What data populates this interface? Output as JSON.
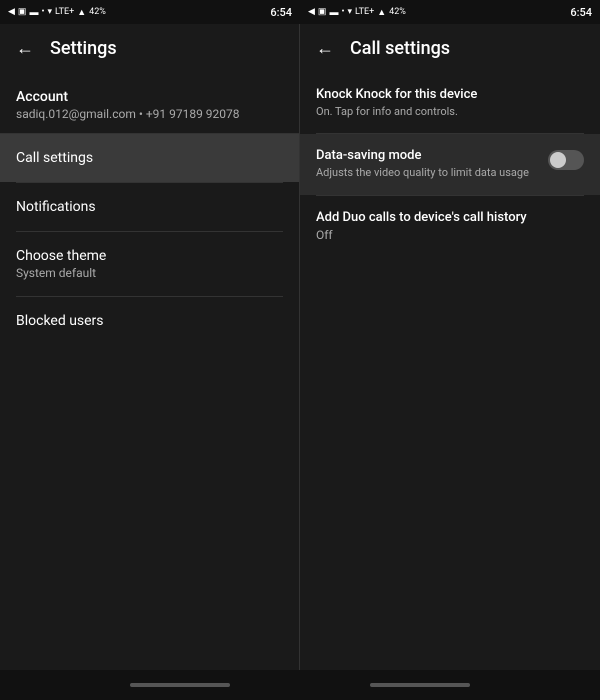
{
  "statusBar": {
    "left": {
      "time": "6:54",
      "icons": [
        "◀",
        "▣",
        "▬",
        "•",
        "•",
        "▾",
        "LTE+",
        "▲",
        "42%"
      ]
    },
    "right": {
      "time": "6:54",
      "icons": [
        "◀",
        "▣",
        "▬",
        "•",
        "•",
        "▾",
        "LTE+",
        "▲",
        "42%"
      ]
    }
  },
  "leftPanel": {
    "header": {
      "backLabel": "←",
      "title": "Settings"
    },
    "account": {
      "label": "Account",
      "info": "sadiq.012@gmail.com • +91 97189 92078"
    },
    "menuItems": [
      {
        "id": "call-settings",
        "title": "Call settings",
        "subtitle": "",
        "active": true
      },
      {
        "id": "notifications",
        "title": "Notifications",
        "subtitle": "",
        "active": false
      },
      {
        "id": "choose-theme",
        "title": "Choose theme",
        "subtitle": "System default",
        "active": false
      },
      {
        "id": "blocked-users",
        "title": "Blocked users",
        "subtitle": "",
        "active": false
      }
    ]
  },
  "rightPanel": {
    "header": {
      "backLabel": "←",
      "title": "Call settings"
    },
    "settings": [
      {
        "id": "knock-knock",
        "title": "Knock Knock for this device",
        "desc": "On. Tap for info and controls.",
        "type": "info",
        "highlighted": false
      },
      {
        "id": "data-saving-mode",
        "title": "Data-saving mode",
        "desc": "Adjusts the video quality to limit data usage",
        "type": "toggle",
        "toggleState": "off",
        "highlighted": true
      },
      {
        "id": "add-duo-calls",
        "title": "Add Duo calls to device's call history",
        "value": "Off",
        "type": "value",
        "highlighted": false
      }
    ]
  },
  "bottomBar": {
    "indicators": [
      "left",
      "right"
    ]
  }
}
